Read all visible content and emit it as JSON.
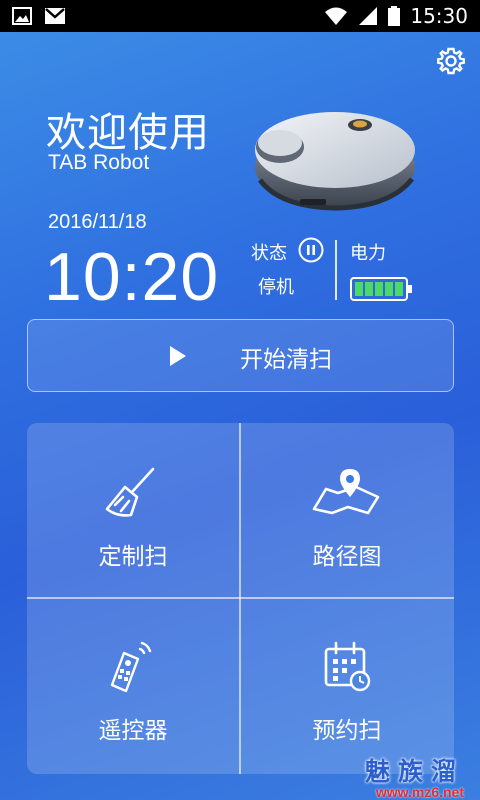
{
  "status_bar": {
    "time": "15:30",
    "icons": [
      "image-icon",
      "gmail-icon",
      "wifi-icon",
      "signal-icon",
      "battery-icon"
    ]
  },
  "header": {
    "settings_icon": "gear-icon",
    "title": "欢迎使用",
    "subtitle": "TAB Robot"
  },
  "info": {
    "date": "2016/11/18",
    "time": "10:20",
    "state_label": "状态",
    "state_value": "停机",
    "power_label": "电力",
    "battery_level": 1.0
  },
  "start_button": {
    "label": "开始清扫"
  },
  "tiles": [
    {
      "label": "定制扫",
      "icon": "broom-icon"
    },
    {
      "label": "路径图",
      "icon": "map-pin-icon"
    },
    {
      "label": "遥控器",
      "icon": "remote-control-icon"
    },
    {
      "label": "预约扫",
      "icon": "calendar-clock-icon"
    }
  ],
  "watermark": {
    "title": "魅族溜",
    "url": "www.mz6.net"
  },
  "colors": {
    "accent_green": "#4cd964",
    "watermark_blue": "#2b5fcf",
    "watermark_red": "#e03030"
  }
}
